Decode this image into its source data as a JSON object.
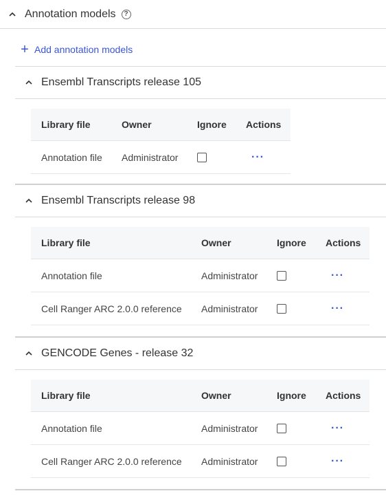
{
  "header": {
    "title": "Annotation models",
    "help_icon": "?"
  },
  "add_button": {
    "label": "Add annotation models"
  },
  "sections": [
    {
      "title": "Ensembl Transcripts release 105",
      "columns": [
        "Library file",
        "Owner",
        "Ignore",
        "Actions"
      ],
      "rows": [
        {
          "library_file": "Annotation file",
          "owner": "Administrator",
          "ignore": false,
          "actions": "···"
        }
      ]
    },
    {
      "title": "Ensembl Transcripts release 98",
      "columns": [
        "Library file",
        "Owner",
        "Ignore",
        "Actions"
      ],
      "rows": [
        {
          "library_file": "Annotation file",
          "owner": "Administrator",
          "ignore": false,
          "actions": "···"
        },
        {
          "library_file": "Cell Ranger ARC 2.0.0 reference",
          "owner": "Administrator",
          "ignore": false,
          "actions": "···"
        }
      ]
    },
    {
      "title": "GENCODE Genes - release 32",
      "columns": [
        "Library file",
        "Owner",
        "Ignore",
        "Actions"
      ],
      "rows": [
        {
          "library_file": "Annotation file",
          "owner": "Administrator",
          "ignore": false,
          "actions": "···"
        },
        {
          "library_file": "Cell Ranger ARC 2.0.0 reference",
          "owner": "Administrator",
          "ignore": false,
          "actions": "···"
        }
      ]
    }
  ]
}
